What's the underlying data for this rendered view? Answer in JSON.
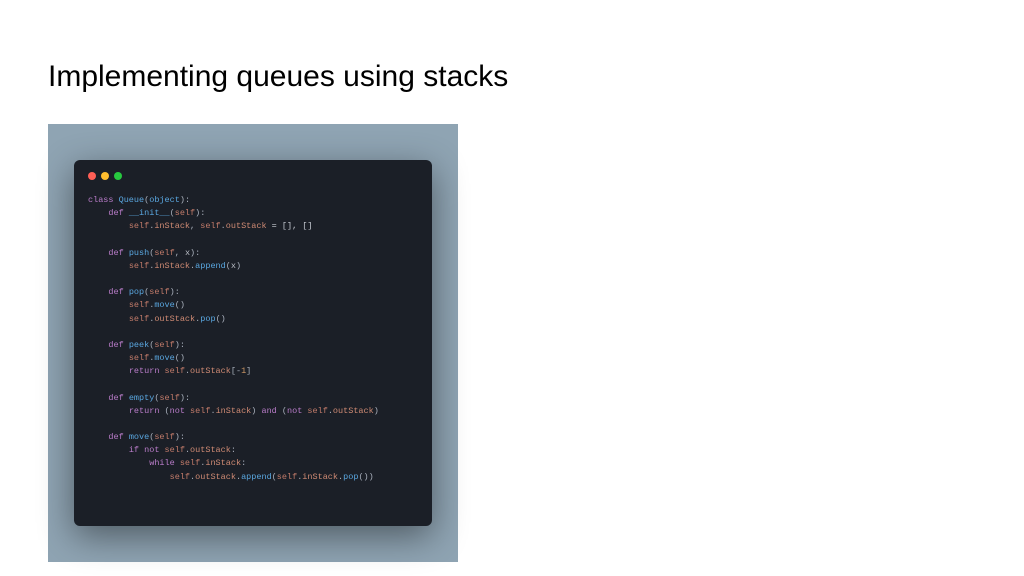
{
  "slide": {
    "title": "Implementing queues using stacks"
  },
  "editor": {
    "window_controls": [
      "close",
      "minimize",
      "zoom"
    ]
  },
  "code": {
    "tokens": [
      [
        {
          "t": "class ",
          "c": "kw"
        },
        {
          "t": "Queue",
          "c": "cls"
        },
        {
          "t": "(",
          "c": "p"
        },
        {
          "t": "object",
          "c": "cls"
        },
        {
          "t": "):",
          "c": "p"
        }
      ],
      [
        {
          "t": "    ",
          "c": "op"
        },
        {
          "t": "def ",
          "c": "kw"
        },
        {
          "t": "__init__",
          "c": "fn"
        },
        {
          "t": "(",
          "c": "p"
        },
        {
          "t": "self",
          "c": "slf"
        },
        {
          "t": "):",
          "c": "p"
        }
      ],
      [
        {
          "t": "        ",
          "c": "op"
        },
        {
          "t": "self",
          "c": "slf"
        },
        {
          "t": ".",
          "c": "p"
        },
        {
          "t": "inStack",
          "c": "attr"
        },
        {
          "t": ", ",
          "c": "p"
        },
        {
          "t": "self",
          "c": "slf"
        },
        {
          "t": ".",
          "c": "p"
        },
        {
          "t": "outStack",
          "c": "attr"
        },
        {
          "t": " = [], []",
          "c": "op"
        }
      ],
      [],
      [
        {
          "t": "    ",
          "c": "op"
        },
        {
          "t": "def ",
          "c": "kw"
        },
        {
          "t": "push",
          "c": "fn"
        },
        {
          "t": "(",
          "c": "p"
        },
        {
          "t": "self",
          "c": "slf"
        },
        {
          "t": ", ",
          "c": "p"
        },
        {
          "t": "x",
          "c": "arg"
        },
        {
          "t": "):",
          "c": "p"
        }
      ],
      [
        {
          "t": "        ",
          "c": "op"
        },
        {
          "t": "self",
          "c": "slf"
        },
        {
          "t": ".",
          "c": "p"
        },
        {
          "t": "inStack",
          "c": "attr"
        },
        {
          "t": ".",
          "c": "p"
        },
        {
          "t": "append",
          "c": "call"
        },
        {
          "t": "(",
          "c": "p"
        },
        {
          "t": "x",
          "c": "arg"
        },
        {
          "t": ")",
          "c": "p"
        }
      ],
      [],
      [
        {
          "t": "    ",
          "c": "op"
        },
        {
          "t": "def ",
          "c": "kw"
        },
        {
          "t": "pop",
          "c": "fn"
        },
        {
          "t": "(",
          "c": "p"
        },
        {
          "t": "self",
          "c": "slf"
        },
        {
          "t": "):",
          "c": "p"
        }
      ],
      [
        {
          "t": "        ",
          "c": "op"
        },
        {
          "t": "self",
          "c": "slf"
        },
        {
          "t": ".",
          "c": "p"
        },
        {
          "t": "move",
          "c": "call"
        },
        {
          "t": "()",
          "c": "p"
        }
      ],
      [
        {
          "t": "        ",
          "c": "op"
        },
        {
          "t": "self",
          "c": "slf"
        },
        {
          "t": ".",
          "c": "p"
        },
        {
          "t": "outStack",
          "c": "attr"
        },
        {
          "t": ".",
          "c": "p"
        },
        {
          "t": "pop",
          "c": "call"
        },
        {
          "t": "()",
          "c": "p"
        }
      ],
      [],
      [
        {
          "t": "    ",
          "c": "op"
        },
        {
          "t": "def ",
          "c": "kw"
        },
        {
          "t": "peek",
          "c": "fn"
        },
        {
          "t": "(",
          "c": "p"
        },
        {
          "t": "self",
          "c": "slf"
        },
        {
          "t": "):",
          "c": "p"
        }
      ],
      [
        {
          "t": "        ",
          "c": "op"
        },
        {
          "t": "self",
          "c": "slf"
        },
        {
          "t": ".",
          "c": "p"
        },
        {
          "t": "move",
          "c": "call"
        },
        {
          "t": "()",
          "c": "p"
        }
      ],
      [
        {
          "t": "        ",
          "c": "op"
        },
        {
          "t": "return ",
          "c": "kw"
        },
        {
          "t": "self",
          "c": "slf"
        },
        {
          "t": ".",
          "c": "p"
        },
        {
          "t": "outStack",
          "c": "attr"
        },
        {
          "t": "[-",
          "c": "p"
        },
        {
          "t": "1",
          "c": "num"
        },
        {
          "t": "]",
          "c": "p"
        }
      ],
      [],
      [
        {
          "t": "    ",
          "c": "op"
        },
        {
          "t": "def ",
          "c": "kw"
        },
        {
          "t": "empty",
          "c": "fn"
        },
        {
          "t": "(",
          "c": "p"
        },
        {
          "t": "self",
          "c": "slf"
        },
        {
          "t": "):",
          "c": "p"
        }
      ],
      [
        {
          "t": "        ",
          "c": "op"
        },
        {
          "t": "return ",
          "c": "kw"
        },
        {
          "t": "(",
          "c": "p"
        },
        {
          "t": "not ",
          "c": "kw"
        },
        {
          "t": "self",
          "c": "slf"
        },
        {
          "t": ".",
          "c": "p"
        },
        {
          "t": "inStack",
          "c": "attr"
        },
        {
          "t": ") ",
          "c": "p"
        },
        {
          "t": "and ",
          "c": "kw"
        },
        {
          "t": "(",
          "c": "p"
        },
        {
          "t": "not ",
          "c": "kw"
        },
        {
          "t": "self",
          "c": "slf"
        },
        {
          "t": ".",
          "c": "p"
        },
        {
          "t": "outStack",
          "c": "attr"
        },
        {
          "t": ")",
          "c": "p"
        }
      ],
      [],
      [
        {
          "t": "    ",
          "c": "op"
        },
        {
          "t": "def ",
          "c": "kw"
        },
        {
          "t": "move",
          "c": "fn"
        },
        {
          "t": "(",
          "c": "p"
        },
        {
          "t": "self",
          "c": "slf"
        },
        {
          "t": "):",
          "c": "p"
        }
      ],
      [
        {
          "t": "        ",
          "c": "op"
        },
        {
          "t": "if ",
          "c": "kw"
        },
        {
          "t": "not ",
          "c": "kw"
        },
        {
          "t": "self",
          "c": "slf"
        },
        {
          "t": ".",
          "c": "p"
        },
        {
          "t": "outStack",
          "c": "attr"
        },
        {
          "t": ":",
          "c": "p"
        }
      ],
      [
        {
          "t": "            ",
          "c": "op"
        },
        {
          "t": "while ",
          "c": "kw"
        },
        {
          "t": "self",
          "c": "slf"
        },
        {
          "t": ".",
          "c": "p"
        },
        {
          "t": "inStack",
          "c": "attr"
        },
        {
          "t": ":",
          "c": "p"
        }
      ],
      [
        {
          "t": "                ",
          "c": "op"
        },
        {
          "t": "self",
          "c": "slf"
        },
        {
          "t": ".",
          "c": "p"
        },
        {
          "t": "outStack",
          "c": "attr"
        },
        {
          "t": ".",
          "c": "p"
        },
        {
          "t": "append",
          "c": "call"
        },
        {
          "t": "(",
          "c": "p"
        },
        {
          "t": "self",
          "c": "slf"
        },
        {
          "t": ".",
          "c": "p"
        },
        {
          "t": "inStack",
          "c": "attr"
        },
        {
          "t": ".",
          "c": "p"
        },
        {
          "t": "pop",
          "c": "call"
        },
        {
          "t": "())",
          "c": "p"
        }
      ]
    ]
  }
}
